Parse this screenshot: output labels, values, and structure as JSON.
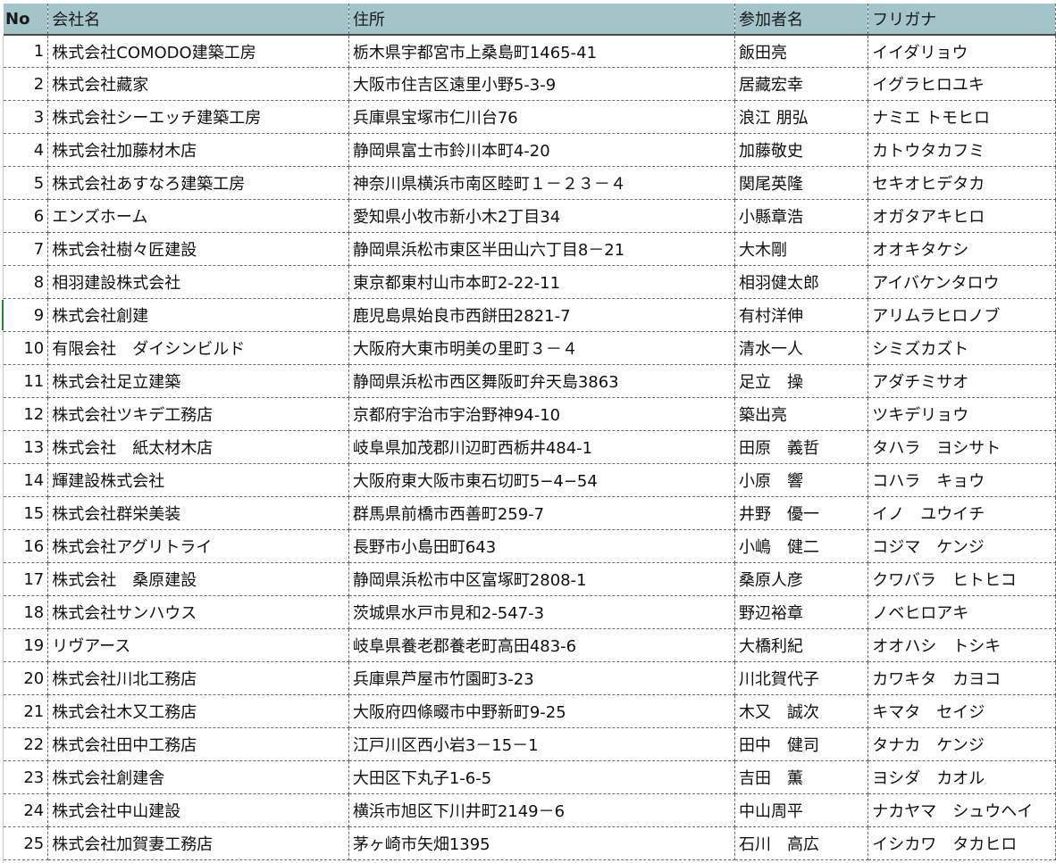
{
  "headers": {
    "no": "No",
    "company": "会社名",
    "address": "住所",
    "participant": "参加者名",
    "furigana": "フリガナ"
  },
  "colors": {
    "header_bg": "#a3c4c9",
    "grid": "#6b6b6b",
    "active_row_marker": "#2e7d32"
  },
  "rows": [
    {
      "no": "1",
      "company": "株式会社COMODO建築工房",
      "address": "栃木県宇都宮市上桑島町1465-41",
      "participant": "飯田亮",
      "furigana": "イイダリョウ"
    },
    {
      "no": "2",
      "company": "株式会社藏家",
      "address": "大阪市住吉区遠里小野5-3-9",
      "participant": "居藏宏幸",
      "furigana": "イグラヒロユキ"
    },
    {
      "no": "3",
      "company": "株式会社シーエッチ建築工房",
      "address": "兵庫県宝塚市仁川台76",
      "participant": "浪江 朋弘",
      "furigana": "ナミエ トモヒロ"
    },
    {
      "no": "4",
      "company": "株式会社加藤材木店",
      "address": "静岡県富士市鈴川本町4-20",
      "participant": "加藤敬史",
      "furigana": "カトウタカフミ"
    },
    {
      "no": "5",
      "company": "株式会社あすなろ建築工房",
      "address": "神奈川県横浜市南区睦町１－２３－４",
      "participant": "関尾英隆",
      "furigana": "セキオヒデタカ"
    },
    {
      "no": "6",
      "company": "エンズホーム",
      "address": "愛知県小牧市新小木2丁目34",
      "participant": "小縣章浩",
      "furigana": "オガタアキヒロ"
    },
    {
      "no": "7",
      "company": "株式会社樹々匠建設",
      "address": "静岡県浜松市東区半田山六丁目8－21",
      "participant": "大木剛",
      "furigana": "オオキタケシ"
    },
    {
      "no": "8",
      "company": "相羽建設株式会社",
      "address": "東京都東村山市本町2-22-11",
      "participant": "相羽健太郎",
      "furigana": "アイバケンタロウ"
    },
    {
      "no": "9",
      "company": "株式会社創建",
      "address": "鹿児島県始良市西餅田2821-7",
      "participant": "有村洋伸",
      "furigana": "アリムラヒロノブ"
    },
    {
      "no": "10",
      "company": "有限会社　ダイシンビルド",
      "address": "大阪府大東市明美の里町３－４",
      "participant": "清水一人",
      "furigana": "シミズカズト"
    },
    {
      "no": "11",
      "company": "株式会社足立建築",
      "address": "静岡県浜松市西区舞阪町弁天島3863",
      "participant": "足立　操",
      "furigana": "アダチミサオ"
    },
    {
      "no": "12",
      "company": "株式会社ツキデ工務店",
      "address": "京都府宇治市宇治野神94-10",
      "participant": "築出亮",
      "furigana": "ツキデリョウ"
    },
    {
      "no": "13",
      "company": "株式会社　紙太材木店",
      "address": "岐阜県加茂郡川辺町西栃井484-1",
      "participant": "田原　義哲",
      "furigana": "タハラ　ヨシサト"
    },
    {
      "no": "14",
      "company": "輝建設株式会社",
      "address": "大阪府東大阪市東石切町5−4−54",
      "participant": "小原　響",
      "furigana": "コハラ　キョウ"
    },
    {
      "no": "15",
      "company": "株式会社群栄美装",
      "address": "群馬県前橋市西善町259-7",
      "participant": "井野　優一",
      "furigana": "イノ　ユウイチ"
    },
    {
      "no": "16",
      "company": "株式会社アグリトライ",
      "address": "長野市小島田町643",
      "participant": "小嶋　健二",
      "furigana": "コジマ　ケンジ"
    },
    {
      "no": "17",
      "company": "株式会社　桑原建設",
      "address": "静岡県浜松市中区富塚町2808-1",
      "participant": "桑原人彦",
      "furigana": "クワバラ　ヒトヒコ"
    },
    {
      "no": "18",
      "company": "株式会社サンハウス",
      "address": "茨城県水戸市見和2-547-3",
      "participant": "野辺裕章",
      "furigana": "ノベヒロアキ"
    },
    {
      "no": "19",
      "company": "リヴアース",
      "address": "岐阜県養老郡養老町高田483-6",
      "participant": "大橋利紀",
      "furigana": "オオハシ　トシキ"
    },
    {
      "no": "20",
      "company": "株式会社川北工務店",
      "address": "兵庫県芦屋市竹園町3-23",
      "participant": "川北賀代子",
      "furigana": "カワキタ　カヨコ"
    },
    {
      "no": "21",
      "company": "株式会社木又工務店",
      "address": "大阪府四條畷市中野新町9-25",
      "participant": "木又　誠次",
      "furigana": "キマタ　セイジ"
    },
    {
      "no": "22",
      "company": "株式会社田中工務店",
      "address": "江戸川区西小岩3－15－1",
      "participant": "田中　健司",
      "furigana": "タナカ　ケンジ"
    },
    {
      "no": "23",
      "company": "株式会社創建舎",
      "address": "大田区下丸子1-6-5",
      "participant": "吉田　薫",
      "furigana": "ヨシダ　カオル"
    },
    {
      "no": "24",
      "company": "株式会社中山建設",
      "address": "横浜市旭区下川井町2149－6",
      "participant": "中山周平",
      "furigana": "ナカヤマ　シュウヘイ"
    },
    {
      "no": "25",
      "company": "株式会社加賀妻工務店",
      "address": "茅ヶ崎市矢畑1395",
      "participant": "石川　高広",
      "furigana": "イシカワ　タカヒロ"
    }
  ]
}
